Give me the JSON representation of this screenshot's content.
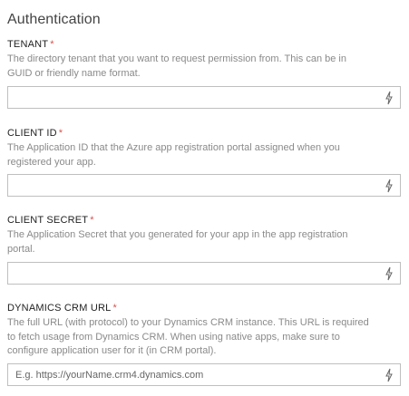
{
  "section": {
    "title": "Authentication"
  },
  "required_marker": "*",
  "fields": [
    {
      "label": "TENANT",
      "description_line1": "The directory tenant that you want to request permission from. This can be in",
      "description_line2": "GUID or friendly name format.",
      "value": "",
      "placeholder": ""
    },
    {
      "label": "CLIENT ID",
      "description_line1": "The Application ID that the Azure app registration portal assigned when you",
      "description_line2": "registered your app.",
      "value": "",
      "placeholder": ""
    },
    {
      "label": "CLIENT SECRET",
      "description_line1": "The Application Secret that you generated for your app in the app registration",
      "description_line2": "portal.",
      "value": "",
      "placeholder": ""
    },
    {
      "label": "DYNAMICS CRM URL",
      "description_line1": "The full URL (with protocol) to your Dynamics CRM instance. This URL is required",
      "description_line2": "to fetch usage from Dynamics CRM. When using native apps, make sure to",
      "description_line3": "configure application user for it (in CRM portal).",
      "value": "",
      "placeholder": "E.g. https://yourName.crm4.dynamics.com"
    }
  ],
  "icons": {
    "input_action": "lightning-bolt-icon"
  },
  "colors": {
    "required": "#d9534f",
    "description": "#8a8a8a",
    "border": "#bfbfbf",
    "title": "#444444"
  }
}
